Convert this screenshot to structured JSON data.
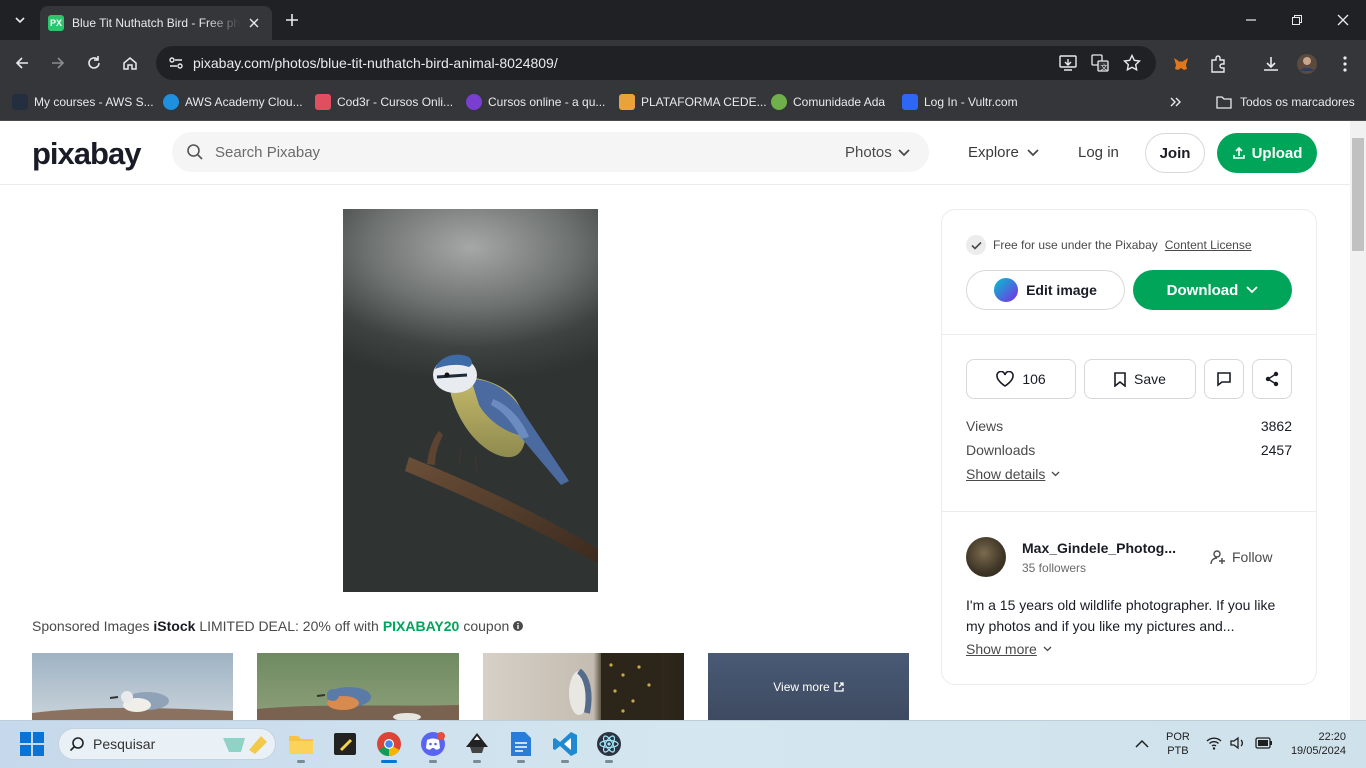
{
  "browser": {
    "tab_title": "Blue Tit Nuthatch Bird - Free photo on Pixabay",
    "tab_favicon": "PX",
    "url": "pixabay.com/photos/blue-tit-nuthatch-bird-animal-8024809/",
    "bookmarks": [
      {
        "label": "My courses - AWS S...",
        "color": "#232f3e"
      },
      {
        "label": "AWS Academy Clou...",
        "color": "#1f8fe0"
      },
      {
        "label": "Cod3r - Cursos Onli...",
        "color": "#e04f5f"
      },
      {
        "label": "Cursos online - a qu...",
        "color": "#7a3fd0"
      },
      {
        "label": "PLATAFORMA CEDE...",
        "color": "#e8a33a"
      },
      {
        "label": "Comunidade Ada",
        "color": "#6fb04a"
      },
      {
        "label": "Log In - Vultr.com",
        "color": "#2e66f5"
      }
    ],
    "all_bookmarks": "Todos os marcadores"
  },
  "header": {
    "logo": "pixabay",
    "search_placeholder": "Search Pixabay",
    "media_type": "Photos",
    "explore": "Explore",
    "login": "Log in",
    "join": "Join",
    "upload": "Upload"
  },
  "sponsored": {
    "prefix": "Sponsored Images",
    "brand": "iStock",
    "text": "LIMITED DEAL: 20% off with",
    "code": "PIXABAY20",
    "suffix": "coupon",
    "view_more": "View more"
  },
  "sidebar": {
    "license_text": "Free for use under the Pixabay",
    "license_link": "Content License",
    "edit_image": "Edit image",
    "download": "Download",
    "likes": "106",
    "save": "Save",
    "stats": [
      {
        "label": "Views",
        "value": "3862"
      },
      {
        "label": "Downloads",
        "value": "2457"
      }
    ],
    "show_details": "Show details",
    "user": {
      "name": "Max_Gindele_Photog...",
      "followers": "35 followers",
      "follow": "Follow",
      "bio": "I'm a 15 years old wildlife photographer. If you like my photos and if you like my pictures and...",
      "show_more": "Show more"
    }
  },
  "taskbar": {
    "search": "Pesquisar",
    "lang_1": "POR",
    "lang_2": "PTB",
    "time": "22:20",
    "date": "19/05/2024"
  },
  "colors": {
    "accent": "#00a55a"
  }
}
